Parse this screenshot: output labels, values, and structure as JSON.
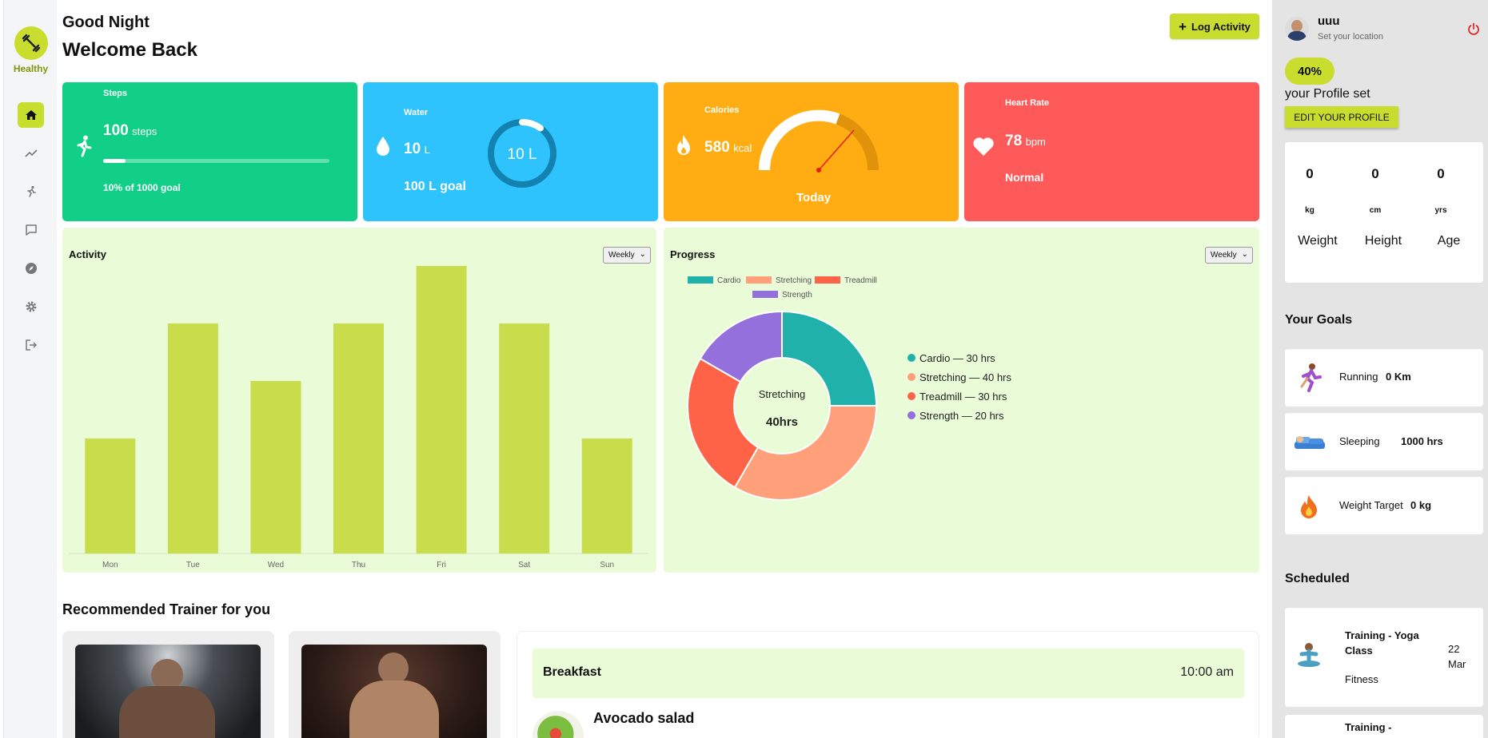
{
  "sidebar": {
    "logo_label": "Healthy"
  },
  "header": {
    "greeting": "Good Night",
    "welcome": "Welcome Back",
    "log_button": "Log Activity"
  },
  "cards": {
    "steps": {
      "label": "Steps",
      "value": "100",
      "unit": "steps",
      "progress": 0.1,
      "goal_text": "10% of 1000 goal",
      "color": "#11cf86"
    },
    "water": {
      "label": "Water",
      "value": "10",
      "unit": "L",
      "goal_text": "100 L goal",
      "ring_text": "10 L",
      "progress": 0.1,
      "color": "#2ec3fd"
    },
    "calories": {
      "label": "Calories",
      "value": "580",
      "unit": "kcal",
      "caption": "Today",
      "color": "#ffad13"
    },
    "heart": {
      "label": "Heart Rate",
      "value": "78",
      "unit": "bpm",
      "status": "Normal",
      "color": "#ff5a5a"
    }
  },
  "activity": {
    "title": "Activity",
    "period": "Weekly"
  },
  "progress": {
    "title": "Progress",
    "period": "Weekly",
    "center_label": "Stretching",
    "center_value": "40hrs"
  },
  "chart_data": [
    {
      "type": "bar",
      "title": "Activity",
      "categories": [
        "Mon",
        "Tue",
        "Wed",
        "Thu",
        "Fri",
        "Sat",
        "Sun"
      ],
      "values": [
        2,
        4,
        3,
        4,
        5,
        4,
        2
      ],
      "ylim": [
        0,
        5
      ],
      "grid": false,
      "color": "#c9dd4c"
    },
    {
      "type": "pie",
      "title": "Progress",
      "categories": [
        "Cardio",
        "Stretching",
        "Treadmill",
        "Strength"
      ],
      "values": [
        30,
        40,
        30,
        20
      ],
      "colors": [
        "#20b2aa",
        "#ffa07a",
        "#ff6347",
        "#9370db"
      ],
      "side_legend": [
        "Cardio — 30 hrs",
        "Stretching — 40 hrs",
        "Treadmill — 30 hrs",
        "Strength — 20 hrs"
      ],
      "legend": "top"
    }
  ],
  "trainers": {
    "title": "Recommended Trainer for you"
  },
  "meal": {
    "name": "Breakfast",
    "time": "10:00 am",
    "dish": "Avocado salad"
  },
  "profile": {
    "name": "uuu",
    "location": "Set your location",
    "percent": "40%",
    "caption": "your Profile set",
    "edit_button": "EDIT YOUR PROFILE",
    "stats": [
      {
        "value": "0",
        "unit": "kg",
        "label": "Weight"
      },
      {
        "value": "0",
        "unit": "cm",
        "label": "Height"
      },
      {
        "value": "0",
        "unit": "yrs",
        "label": "Age"
      }
    ]
  },
  "goals": {
    "title": "Your Goals",
    "items": [
      {
        "label": "Running",
        "value": "0 Km",
        "icon": "runner-icon"
      },
      {
        "label": "Sleeping",
        "value": "1000 hrs",
        "icon": "sleeping-icon"
      },
      {
        "label": "Weight Target",
        "value": "0 kg",
        "icon": "fire-icon"
      }
    ]
  },
  "scheduled": {
    "title": "Scheduled",
    "items": [
      {
        "title": "Training - Yoga Class",
        "category": "Fitness",
        "date": "22 Mar"
      },
      {
        "title": "Training -"
      }
    ]
  }
}
